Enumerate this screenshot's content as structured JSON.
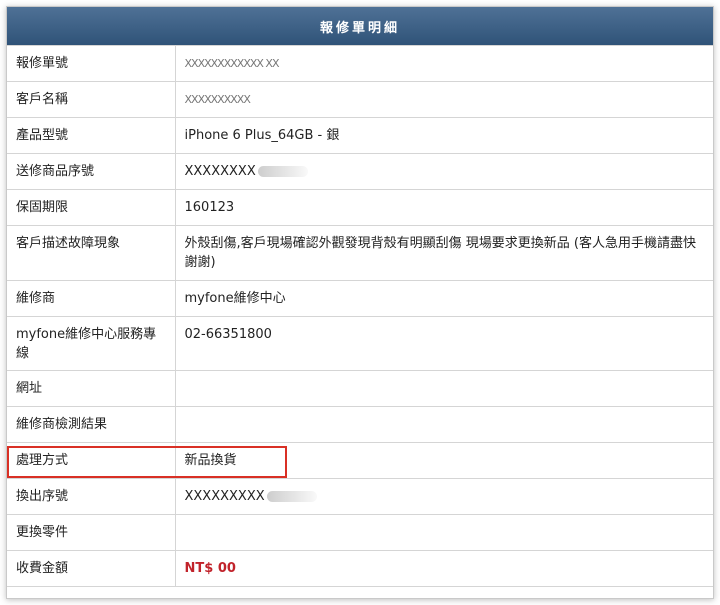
{
  "header": {
    "title": "報修單明細"
  },
  "rows": [
    {
      "label": "報修單號",
      "value": "XXXXXXXXXXXX XX"
    },
    {
      "label": "客戶名稱",
      "value": "XXXXXXXXXX"
    },
    {
      "label": "產品型號",
      "value": "iPhone 6 Plus_64GB - 銀"
    },
    {
      "label": "送修商品序號",
      "value": "XXXXXXXX"
    },
    {
      "label": "保固期限",
      "value": "160123"
    },
    {
      "label": "客戶描述故障現象",
      "value": "外殼刮傷,客戶現場確認外觀發現背殼有明顯刮傷 現場要求更換新品 (客人急用手機請盡快謝謝)"
    },
    {
      "label": "維修商",
      "value": "myfone維修中心"
    },
    {
      "label": "myfone維修中心服務專線",
      "value": "02-66351800"
    },
    {
      "label": "網址",
      "value": ""
    },
    {
      "label": "維修商檢測結果",
      "value": ""
    },
    {
      "label": "處理方式",
      "value": "新品換貨"
    },
    {
      "label": "換出序號",
      "value": "XXXXXXXXX"
    },
    {
      "label": "更換零件",
      "value": ""
    },
    {
      "label": "收費金額",
      "value": "NT$ 00"
    }
  ],
  "colors": {
    "header_bg": "#3a5f85",
    "highlight": "#d93025",
    "fee": "#c1232b"
  }
}
